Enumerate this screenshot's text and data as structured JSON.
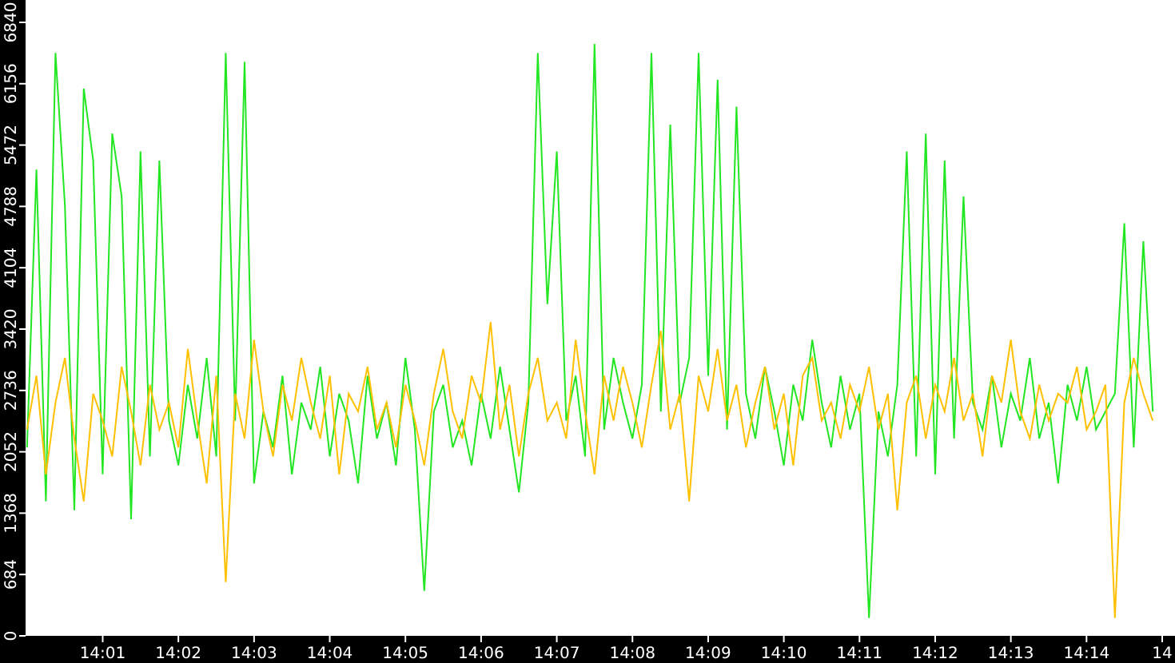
{
  "chart": {
    "chart_data": {
      "type": "line",
      "ylim": [
        0,
        6840
      ],
      "yticks": [
        0,
        684,
        1368,
        2052,
        2736,
        3420,
        4104,
        4788,
        5472,
        6156,
        6840
      ],
      "categories": [
        null,
        null,
        null,
        null,
        null,
        null,
        null,
        null,
        "14:01",
        null,
        null,
        null,
        null,
        null,
        null,
        null,
        "14:02",
        null,
        null,
        null,
        null,
        null,
        null,
        null,
        "14:03",
        null,
        null,
        null,
        null,
        null,
        null,
        null,
        "14:04",
        null,
        null,
        null,
        null,
        null,
        null,
        null,
        "14:05",
        null,
        null,
        null,
        null,
        null,
        null,
        null,
        "14:06",
        null,
        null,
        null,
        null,
        null,
        null,
        null,
        "14:07",
        null,
        null,
        null,
        null,
        null,
        null,
        null,
        "14:08",
        null,
        null,
        null,
        null,
        null,
        null,
        null,
        "14:09",
        null,
        null,
        null,
        null,
        null,
        null,
        null,
        "14:10",
        null,
        null,
        null,
        null,
        null,
        null,
        null,
        "14:11",
        null,
        null,
        null,
        null,
        null,
        null,
        null,
        "14:12",
        null,
        null,
        null,
        null,
        null,
        null,
        null,
        "14:13",
        null,
        null,
        null,
        null,
        null,
        null,
        null,
        "14:14",
        null,
        null,
        null,
        null,
        null,
        null,
        null,
        "14"
      ],
      "series": [
        {
          "color": "#22e622",
          "values": [
            2100,
            5200,
            1500,
            6500,
            4800,
            1400,
            6100,
            5300,
            1800,
            5600,
            4900,
            1300,
            5400,
            2000,
            5300,
            2400,
            1900,
            2800,
            2200,
            3100,
            2000,
            6500,
            2400,
            6400,
            1700,
            2500,
            2100,
            2900,
            1800,
            2600,
            2300,
            3000,
            2000,
            2700,
            2400,
            1700,
            2900,
            2200,
            2600,
            1900,
            3100,
            2300,
            500,
            2500,
            2800,
            2100,
            2400,
            1900,
            2700,
            2200,
            3000,
            2300,
            1600,
            2600,
            6500,
            3700,
            5400,
            2400,
            2900,
            2000,
            6600,
            2300,
            3100,
            2600,
            2200,
            2800,
            6500,
            2500,
            5700,
            2600,
            3100,
            6500,
            2900,
            6200,
            2300,
            5900,
            2700,
            2200,
            3000,
            2500,
            1900,
            2800,
            2400,
            3300,
            2600,
            2100,
            2900,
            2300,
            2700,
            200,
            2500,
            2000,
            2800,
            5400,
            2000,
            5600,
            1800,
            5300,
            2200,
            4900,
            2600,
            2300,
            2900,
            2100,
            2700,
            2400,
            3100,
            2200,
            2600,
            1700,
            2800,
            2400,
            3000,
            2300,
            2500,
            2700,
            4600,
            2100,
            4400,
            2500,
            null
          ]
        },
        {
          "color": "#ffc000",
          "values": [
            2300,
            2900,
            1800,
            2600,
            3100,
            2200,
            1500,
            2700,
            2400,
            2000,
            3000,
            2500,
            1900,
            2800,
            2300,
            2600,
            2100,
            3200,
            2400,
            1700,
            2900,
            600,
            2700,
            2200,
            3300,
            2500,
            2000,
            2800,
            2400,
            3100,
            2600,
            2200,
            2900,
            1800,
            2700,
            2500,
            3000,
            2300,
            2600,
            2100,
            2800,
            2400,
            1900,
            2700,
            3200,
            2500,
            2200,
            2900,
            2600,
            3500,
            2300,
            2800,
            2000,
            2700,
            3100,
            2400,
            2600,
            2200,
            3300,
            2500,
            1800,
            2900,
            2400,
            3000,
            2600,
            2100,
            2800,
            3400,
            2300,
            2700,
            1500,
            2900,
            2500,
            3200,
            2400,
            2800,
            2100,
            2600,
            3000,
            2300,
            2700,
            1900,
            2900,
            3100,
            2400,
            2600,
            2200,
            2800,
            2500,
            3000,
            2300,
            2700,
            1400,
            2600,
            2900,
            2200,
            2800,
            2500,
            3100,
            2400,
            2700,
            2000,
            2900,
            2600,
            3300,
            2500,
            2200,
            2800,
            2400,
            2700,
            2600,
            3000,
            2300,
            2500,
            2800,
            200,
            2600,
            3100,
            2700,
            2400,
            null
          ]
        }
      ]
    }
  }
}
